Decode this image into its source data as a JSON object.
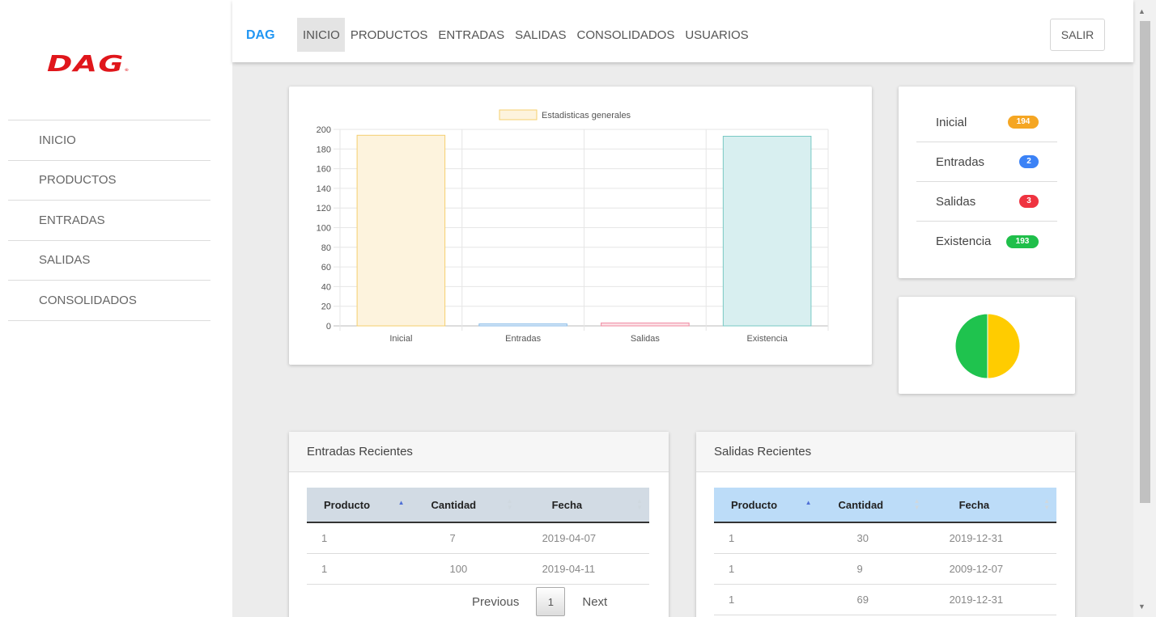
{
  "sidebar": {
    "logo": "DAG",
    "items": [
      {
        "label": "INICIO"
      },
      {
        "label": "PRODUCTOS"
      },
      {
        "label": "ENTRADAS"
      },
      {
        "label": "SALIDAS"
      },
      {
        "label": "CONSOLIDADOS"
      }
    ]
  },
  "topbar": {
    "brand": "DAG",
    "nav": [
      {
        "label": "INICIO",
        "active": true
      },
      {
        "label": "PRODUCTOS"
      },
      {
        "label": "ENTRADAS"
      },
      {
        "label": "SALIDAS"
      },
      {
        "label": "CONSOLIDADOS"
      },
      {
        "label": "USUARIOS"
      }
    ],
    "logout_label": "SALIR"
  },
  "chart_data": {
    "type": "bar",
    "categories": [
      "Inicial",
      "Entradas",
      "Salidas",
      "Existencia"
    ],
    "series": [
      {
        "name": "Estadisticas generales",
        "values": [
          194,
          2,
          3,
          193
        ]
      }
    ],
    "colors": {
      "fills": [
        "#fdf3dd",
        "#ddecfa",
        "#fbe1e6",
        "#d8eff0"
      ],
      "borders": [
        "#f5cf6e",
        "#8bbde8",
        "#f08ba2",
        "#79c9c4"
      ]
    },
    "ylim": [
      0,
      200
    ],
    "yticks": [
      0,
      20,
      40,
      60,
      80,
      100,
      120,
      140,
      160,
      180,
      200
    ],
    "grid": true,
    "legend_position": "top"
  },
  "stats": [
    {
      "label": "Inicial",
      "value": "194",
      "color": "#f5a623"
    },
    {
      "label": "Entradas",
      "value": "2",
      "color": "#3b82f6"
    },
    {
      "label": "Salidas",
      "value": "3",
      "color": "#ef3340"
    },
    {
      "label": "Existencia",
      "value": "193",
      "color": "#1fbf4a"
    }
  ],
  "pie": {
    "slices": [
      {
        "value": 0.5,
        "color": "#ffcc00"
      },
      {
        "value": 0.5,
        "color": "#1fc34e"
      }
    ]
  },
  "entradas": {
    "title": "Entradas Recientes",
    "columns": [
      "Producto",
      "Cantidad",
      "Fecha"
    ],
    "rows": [
      [
        "1",
        "7",
        "2019-04-07"
      ],
      [
        "1",
        "100",
        "2019-04-11"
      ]
    ],
    "pager": {
      "prev": "Previous",
      "page": "1",
      "next": "Next"
    }
  },
  "salidas": {
    "title": "Salidas Recientes",
    "columns": [
      "Producto",
      "Cantidad",
      "Fecha"
    ],
    "rows": [
      [
        "1",
        "30",
        "2019-12-31"
      ],
      [
        "1",
        "9",
        "2009-12-07"
      ],
      [
        "1",
        "69",
        "2019-12-31"
      ]
    ]
  }
}
